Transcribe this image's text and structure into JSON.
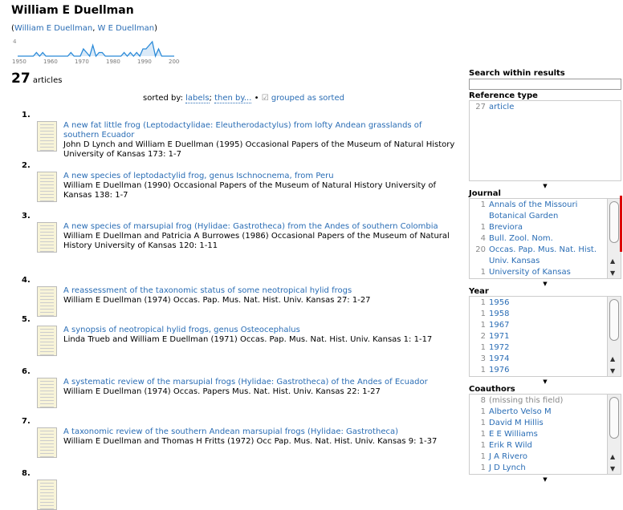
{
  "title": "William E Duellman",
  "aliases": {
    "open": "(",
    "a1": "William E Duellman",
    "sep": ", ",
    "a2": "W E Duellman",
    "close": ")"
  },
  "sparkline": {
    "ymax_label": "4",
    "x_labels": [
      "1950",
      "1960",
      "1970",
      "1980",
      "1990",
      "2000"
    ],
    "years": [
      1956,
      1958,
      1967,
      1971,
      1972,
      1974,
      1976,
      1977,
      1984,
      1986,
      1988,
      1990,
      1991,
      1992,
      1993,
      1995
    ],
    "counts": [
      1,
      1,
      1,
      2,
      1,
      3,
      1,
      1,
      1,
      1,
      1,
      2,
      2,
      3,
      4,
      2
    ],
    "color": "#2a8ad8"
  },
  "count": {
    "value": "27",
    "label": "articles"
  },
  "sortbar": {
    "prefix": "sorted by:",
    "labels": "labels",
    "sep": ";",
    "then": "then by...",
    "bullet": "•",
    "grouped": "grouped as sorted"
  },
  "entries": [
    {
      "num": "1.",
      "title": "A new fat little frog (Leptodactylidae: Eleutherodactylus) from lofty Andean grasslands of southern Ecuador",
      "cite": "John D Lynch and William E Duellman (1995) Occasional Papers of the Museum of Natural History University of Kansas 173: 1-7"
    },
    {
      "num": "2.",
      "title": "A new species of leptodactylid frog, genus Ischnocnema, from Peru",
      "cite": "William E Duellman (1990) Occasional Papers of the Museum of Natural History University of Kansas 138: 1-7"
    },
    {
      "num": "3.",
      "title": "A new species of marsupial frog (Hylidae: Gastrotheca) from the Andes of southern Colombia",
      "cite": "William E Duellman and Patricia A Burrowes (1986) Occasional Papers of the Museum of Natural History University of Kansas 120: 1-11"
    },
    {
      "num": "4.",
      "title": "A reassessment of the taxonomic status of some neotropical hylid frogs",
      "cite": "William E Duellman (1974) Occas. Pap. Mus. Nat. Hist. Univ. Kansas 27: 1-27"
    },
    {
      "num": "5.",
      "title": "A synopsis of neotropical hylid frogs, genus Osteocephalus",
      "cite": "Linda Trueb and William E Duellman (1971) Occas. Pap. Mus. Nat. Hist. Univ. Kansas 1: 1-17"
    },
    {
      "num": "6.",
      "title": "A systematic review of the marsupial frogs (Hylidae: Gastrotheca) of the Andes of Ecuador",
      "cite": "William E Duellman (1974) Occas. Papers Mus. Nat. Hist. Univ. Kansas 22: 1-27"
    },
    {
      "num": "7.",
      "title": "A taxonomic review of the southern Andean marsupial frogs (Hylidae: Gastrotheca)",
      "cite": "William E Duellman and Thomas H Fritts (1972) Occ Pap. Mus. Nat. Hist. Univ. Kansas 9: 1-37"
    },
    {
      "num": "8.",
      "title": "",
      "cite": ""
    }
  ],
  "sidebar": {
    "search_label": "Search within results",
    "search_value": "",
    "facets": [
      {
        "label": "Reference type",
        "items": [
          {
            "c": "27",
            "l": "article"
          }
        ]
      },
      {
        "label": "Journal",
        "items": [
          {
            "c": "1",
            "l": "Annals of the Missouri Botanical Garden"
          },
          {
            "c": "1",
            "l": "Breviora"
          },
          {
            "c": "4",
            "l": "Bull. Zool. Nom."
          },
          {
            "c": "20",
            "l": "Occas. Pap. Mus. Nat. Hist. Univ. Kansas"
          },
          {
            "c": "1",
            "l": "University of Kansas Science Bulletin"
          }
        ]
      },
      {
        "label": "Year",
        "items": [
          {
            "c": "1",
            "l": "1956"
          },
          {
            "c": "1",
            "l": "1958"
          },
          {
            "c": "1",
            "l": "1967"
          },
          {
            "c": "2",
            "l": "1971"
          },
          {
            "c": "1",
            "l": "1972"
          },
          {
            "c": "3",
            "l": "1974"
          },
          {
            "c": "1",
            "l": "1976"
          }
        ]
      },
      {
        "label": "Coauthors",
        "items": [
          {
            "c": "8",
            "l": "(missing this field)"
          },
          {
            "c": "1",
            "l": "Alberto Velso M"
          },
          {
            "c": "1",
            "l": "David M Hillis"
          },
          {
            "c": "1",
            "l": "E E Williams"
          },
          {
            "c": "1",
            "l": "Erik R Wild"
          },
          {
            "c": "1",
            "l": "J A Rivero"
          },
          {
            "c": "1",
            "l": "J D Lynch"
          }
        ]
      }
    ]
  }
}
